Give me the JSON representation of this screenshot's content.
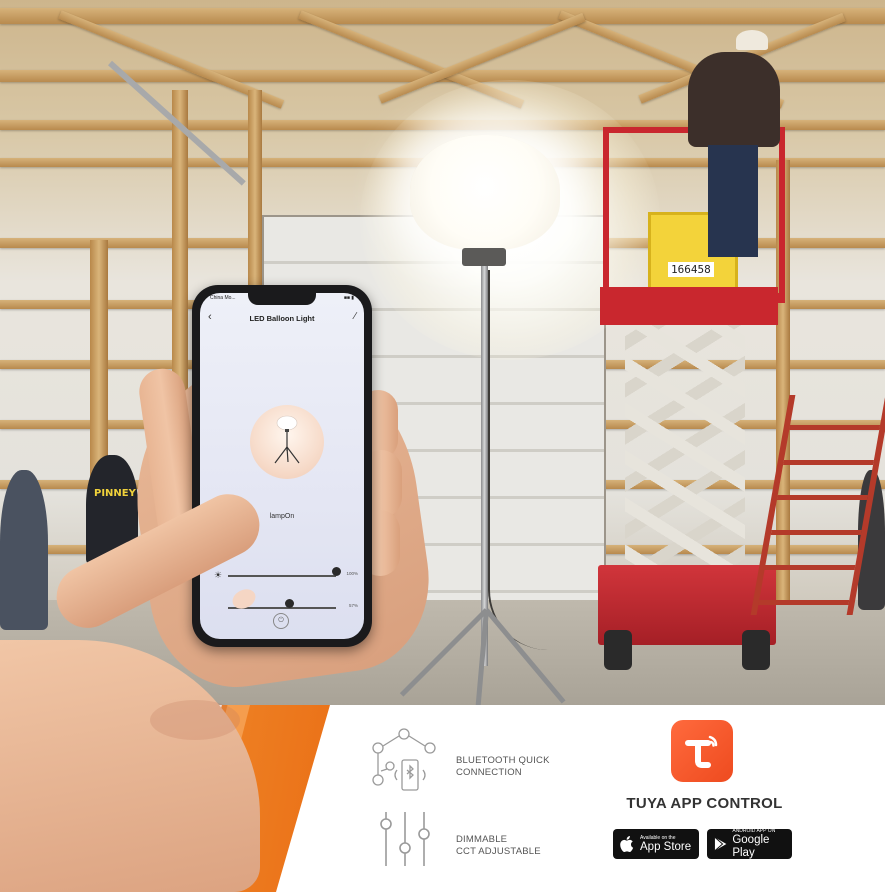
{
  "phone": {
    "carrier": "China Mo...",
    "status_right": "■■ ▮",
    "back_glyph": "‹",
    "title": "LED Balloon Light",
    "edit_glyph": "∕",
    "device_status": "lampOn",
    "brightness_icon": "sun-icon",
    "brightness_level": 1.0,
    "brightness_label": "100%",
    "cct_level": 0.57,
    "cct_label": "57%",
    "power_glyph": "⏻"
  },
  "lift": {
    "id_plate": "166458"
  },
  "features": [
    {
      "icon": "bluetooth-network-icon",
      "line1": "BLUETOOTH QUICK",
      "line2": "CONNECTION"
    },
    {
      "icon": "mixer-sliders-icon",
      "line1": "DIMMABLE",
      "line2": "CCT ADJUSTABLE"
    }
  ],
  "tuya": {
    "title": "TUYA APP CONTROL",
    "appstore_small": "Available on the",
    "appstore_big": "App Store",
    "googleplay_small": "ANDROID APP ON",
    "googleplay_big": "Google Play"
  },
  "colors": {
    "accent_orange": "#EA6F16",
    "tuya_orange": "#FF6A3D",
    "lift_red": "#C9272E"
  }
}
